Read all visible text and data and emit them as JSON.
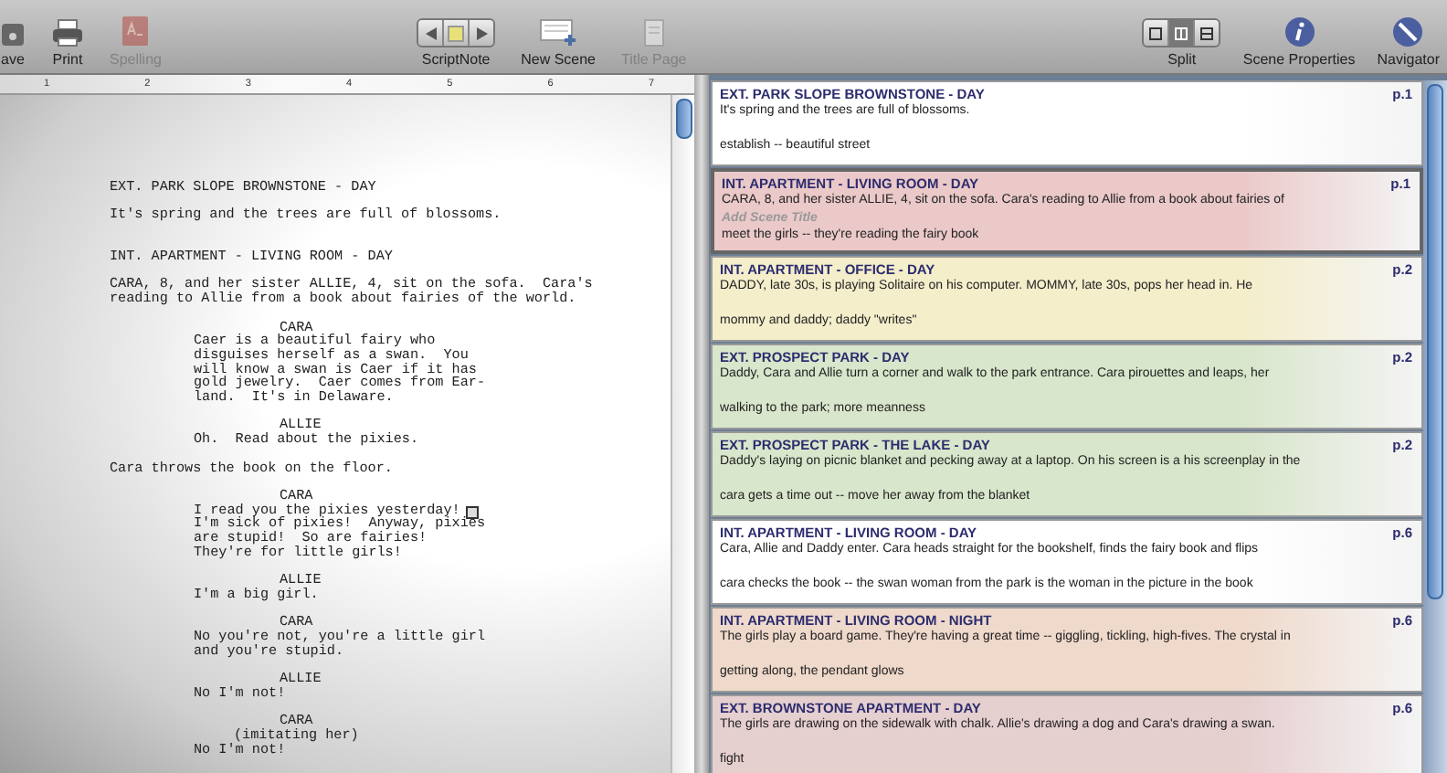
{
  "toolbar": {
    "left": [
      {
        "kind": "save",
        "label": "ave"
      },
      {
        "kind": "print",
        "label": "Print"
      },
      {
        "kind": "spelling",
        "label": "Spelling",
        "disabled": true
      }
    ],
    "center": [
      {
        "kind": "scriptnote",
        "label": "ScriptNote"
      },
      {
        "kind": "newscene",
        "label": "New Scene"
      },
      {
        "kind": "titlepage",
        "label": "Title Page",
        "disabled": true
      }
    ],
    "right": [
      {
        "kind": "split",
        "label": "Split",
        "modes": [
          {
            "selected": false
          },
          {
            "selected": true
          },
          {
            "selected": false
          }
        ]
      },
      {
        "kind": "info",
        "label": "Scene Properties"
      },
      {
        "kind": "navigator",
        "label": "Navigator"
      }
    ]
  },
  "ruler": {
    "marks": [
      "1",
      "2",
      "3",
      "4",
      "5",
      "6",
      "7"
    ]
  },
  "script": [
    {
      "kind": "heading",
      "lines": [
        "EXT. PARK SLOPE BROWNSTONE - DAY"
      ]
    },
    {
      "kind": "action",
      "lines": [
        "It's spring and the trees are full of blossoms."
      ]
    },
    {
      "kind": "heading",
      "lines": [
        "INT. APARTMENT - LIVING ROOM - DAY"
      ]
    },
    {
      "kind": "action",
      "lines": [
        "CARA, 8, and her sister ALLIE, 4, sit on the sofa.  Cara's",
        "reading to Allie from a book about fairies of the world."
      ]
    },
    {
      "kind": "character",
      "lines": [
        "CARA"
      ]
    },
    {
      "kind": "dialogue",
      "lines": [
        "Caer is a beautiful fairy who",
        "disguises herself as a swan.  You",
        "will know a swan is Caer if it has",
        "gold jewelry.  Caer comes from Ear-",
        "land.  It's in Delaware."
      ]
    },
    {
      "kind": "character",
      "lines": [
        "ALLIE"
      ]
    },
    {
      "kind": "dialogue",
      "lines": [
        "Oh.  Read about the pixies."
      ]
    },
    {
      "kind": "action",
      "lines": [
        "Cara throws the book on the floor."
      ]
    },
    {
      "kind": "character",
      "lines": [
        "CARA"
      ]
    },
    {
      "kind": "dialogue",
      "lines": [
        "I read you the pixies yesterday!",
        "I'm sick of pixies!  Anyway, pixies",
        "are stupid!  So are fairies!",
        "They're for little girls!"
      ],
      "note": true
    },
    {
      "kind": "character",
      "lines": [
        "ALLIE"
      ]
    },
    {
      "kind": "dialogue",
      "lines": [
        "I'm a big girl."
      ]
    },
    {
      "kind": "character",
      "lines": [
        "CARA"
      ]
    },
    {
      "kind": "dialogue",
      "lines": [
        "No you're not, you're a little girl",
        "and you're stupid."
      ]
    },
    {
      "kind": "character",
      "lines": [
        "ALLIE"
      ]
    },
    {
      "kind": "dialogue",
      "lines": [
        "No I'm not!"
      ]
    },
    {
      "kind": "character",
      "lines": [
        "CARA"
      ]
    },
    {
      "kind": "parenthetical",
      "lines": [
        "(imitating her)"
      ]
    },
    {
      "kind": "dialogue",
      "lines": [
        "No I'm not!"
      ]
    }
  ],
  "scenes": [
    {
      "heading": "EXT. PARK SLOPE BROWNSTONE - DAY",
      "page": "p.1",
      "summary": "It's spring and the trees are full of blossoms.",
      "note": "establish -- beautiful street",
      "color": "#ffffff",
      "selected": false
    },
    {
      "heading": "INT. APARTMENT - LIVING ROOM - DAY",
      "page": "p.1",
      "summary": "CARA, 8, and her sister ALLIE, 4, sit on the sofa.  Cara's reading to Allie from a book about fairies of",
      "title_placeholder": "Add Scene Title",
      "note": "meet the girls -- they're reading the fairy book",
      "color": "#ebc9c9",
      "selected": true
    },
    {
      "heading": "INT. APARTMENT - OFFICE - DAY",
      "page": "p.2",
      "summary": "DADDY, late 30s, is playing Solitaire on his computer.  MOMMY, late 30s, pops her head in.  He",
      "note": "mommy and daddy; daddy \"writes\"",
      "color": "#f4eecb",
      "selected": false
    },
    {
      "heading": "EXT. PROSPECT PARK - DAY",
      "page": "p.2",
      "summary": "Daddy, Cara and Allie turn a corner and walk to the park entrance.  Cara pirouettes and leaps, her",
      "note": "walking to the park; more meanness",
      "color": "#d8e6cb",
      "selected": false
    },
    {
      "heading": "EXT. PROSPECT PARK - THE LAKE - DAY",
      "page": "p.2",
      "summary": "Daddy's laying on picnic blanket and pecking away at a laptop.  On his screen is a his screenplay in the",
      "note": "cara gets a time out -- move her away from the blanket",
      "color": "#d8e6cb",
      "selected": false
    },
    {
      "heading": "INT. APARTMENT - LIVING ROOM - DAY",
      "page": "p.6",
      "summary": "Cara, Allie and Daddy enter.  Cara heads straight for the bookshelf, finds the fairy book and flips",
      "note": "cara checks the book -- the swan woman from the park is the woman in the picture in the book",
      "color": "#ffffff",
      "selected": false
    },
    {
      "heading": "INT. APARTMENT - LIVING ROOM - NIGHT",
      "page": "p.6",
      "summary": "The girls play a board game. They're having a great time -- giggling, tickling, high-fives.  The crystal in",
      "note": "getting along, the pendant glows",
      "color": "#efd9cb",
      "selected": false
    },
    {
      "heading": "EXT. BROWNSTONE APARTMENT - DAY",
      "page": "p.6",
      "summary": "The girls are drawing on the sidewalk with chalk.  Allie's drawing a dog and Cara's drawing a swan.",
      "note": "fight",
      "color": "#e6cfcf",
      "selected": false
    }
  ]
}
